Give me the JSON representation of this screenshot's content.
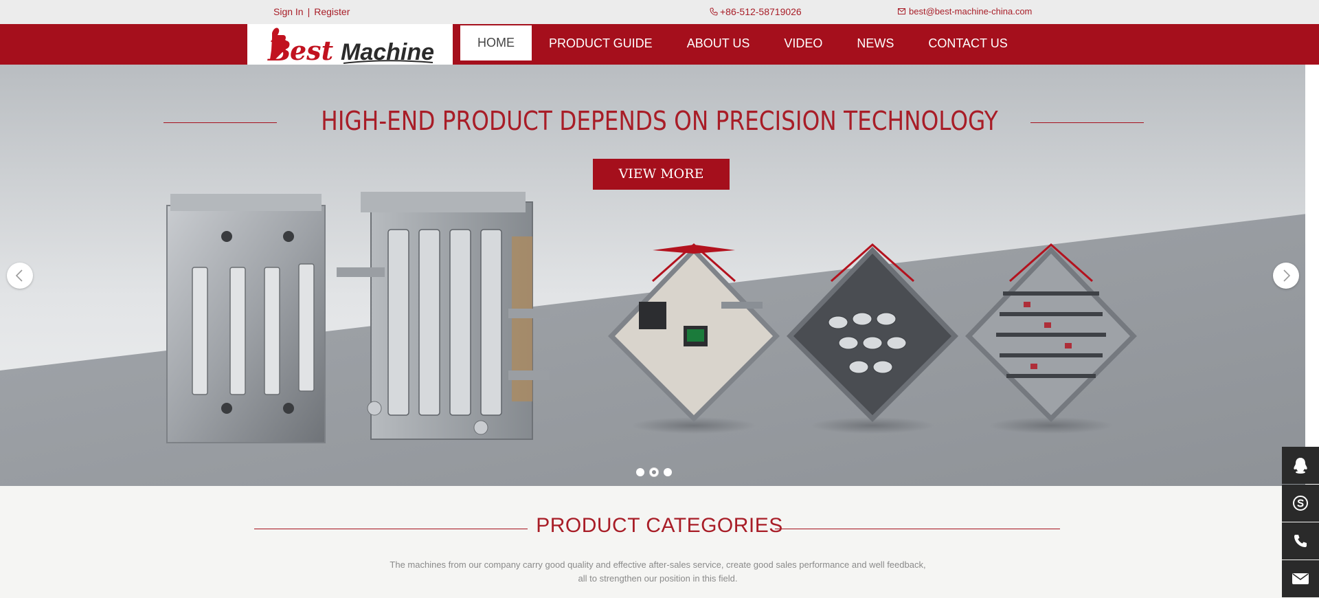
{
  "topbar": {
    "sign_in": "Sign In",
    "separator": "|",
    "register": "Register",
    "phone": "+86-512-58719026",
    "email": "best@best-machine-china.com"
  },
  "logo": {
    "brand_1": "Best",
    "brand_2": "Machine"
  },
  "nav": [
    {
      "label": "HOME",
      "active": true
    },
    {
      "label": "PRODUCT GUIDE"
    },
    {
      "label": "ABOUT US"
    },
    {
      "label": "VIDEO"
    },
    {
      "label": "NEWS"
    },
    {
      "label": "CONTACT US"
    }
  ],
  "banner": {
    "headline": "HIGH-END PRODUCT DEPENDS ON PRECISION TECHNOLOGY",
    "cta": "VIEW MORE",
    "slides_count": 3,
    "active_slide": 2
  },
  "categories": {
    "title": "PRODUCT CATEGORIES",
    "description_line1": "The machines from our company carry good quality and effective after-sales service, create good sales performance and well feedback,",
    "description_line2": "all to strengthen our position in this field."
  },
  "side_tools": [
    "qq-icon",
    "skype-icon",
    "phone-icon",
    "mail-icon"
  ],
  "colors": {
    "brand_red": "#a50f1c",
    "text_red": "#a81d27",
    "topbar_bg": "#ececec",
    "side_bg": "#2a2a2a"
  }
}
